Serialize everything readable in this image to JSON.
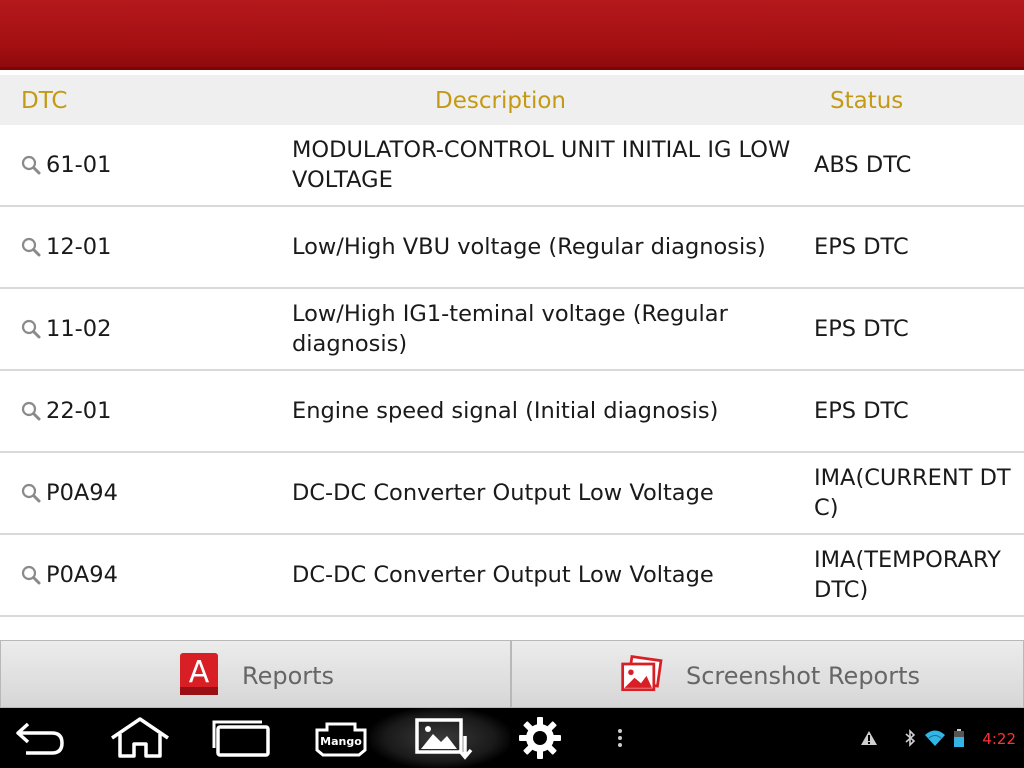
{
  "header": {
    "columns": {
      "dtc": "DTC",
      "description": "Description",
      "status": "Status"
    }
  },
  "rows": [
    {
      "code": "61-01",
      "description": "MODULATOR-CONTROL UNIT INITIAL IG LOW VOLTAGE",
      "status": "ABS DTC"
    },
    {
      "code": "12-01",
      "description": "Low/High VBU voltage (Regular diagnosis)",
      "status": "EPS DTC"
    },
    {
      "code": "11-02",
      "description": "Low/High IG1-teminal voltage (Regular diagnosis)",
      "status": "EPS DTC"
    },
    {
      "code": "22-01",
      "description": "Engine speed signal (Initial diagnosis)",
      "status": "EPS DTC"
    },
    {
      "code": "P0A94",
      "description": "DC-DC Converter Output Low Voltage",
      "status": "IMA(CURRENT DTC)"
    },
    {
      "code": "P0A94",
      "description": "DC-DC Converter Output Low Voltage",
      "status": "IMA(TEMPORARY DTC)"
    }
  ],
  "bottom_tabs": {
    "reports_label": "Reports",
    "reports_icon": "reports-a-icon",
    "screenshot_label": "Screenshot Reports",
    "screenshot_icon": "screenshot-gallery-icon"
  },
  "system_bar": {
    "nav_icons": [
      "back-icon",
      "home-icon",
      "recent-apps-icon",
      "mango-app-icon",
      "screenshot-icon",
      "settings-icon",
      "overflow-menu-icon"
    ],
    "status_icons": [
      "warning-icon",
      "bluetooth-icon",
      "wifi-icon",
      "battery-icon"
    ],
    "time": "4:22"
  },
  "colors": {
    "brand_red": "#a30f12",
    "header_gold": "#c49a14",
    "clock_red": "#ff3030"
  }
}
